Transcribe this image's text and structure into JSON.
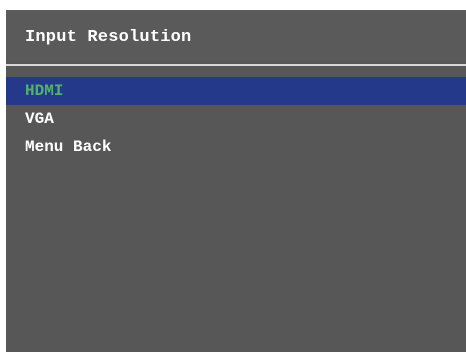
{
  "menu": {
    "title": "Input Resolution",
    "items": [
      {
        "label": "HDMI",
        "selected": true
      },
      {
        "label": "VGA",
        "selected": false
      },
      {
        "label": "Menu Back",
        "selected": false
      }
    ]
  },
  "colors": {
    "panel_background": "#575757",
    "selection_background": "#25398a",
    "selected_text": "#4fb46a",
    "text": "#ffffff",
    "divider": "#d8d8d8"
  }
}
